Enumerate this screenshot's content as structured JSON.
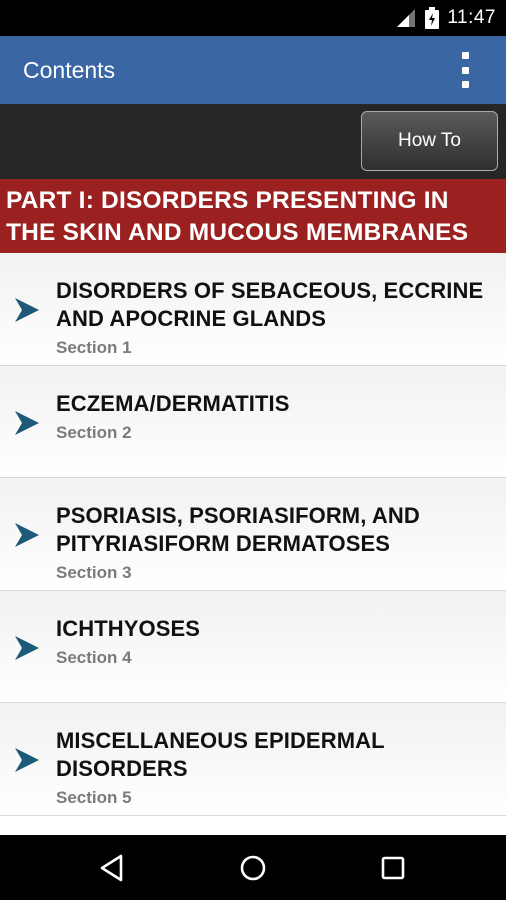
{
  "status_bar": {
    "time": "11:47"
  },
  "app_bar": {
    "title": "Contents",
    "menu_icon": "overflow-menu-icon"
  },
  "toolbar": {
    "how_to_label": "How To"
  },
  "part_header": {
    "title": "PART I: DISORDERS PRESENTING IN THE SKIN AND MUCOUS MEMBRANES"
  },
  "sections": [
    {
      "title": "DISORDERS OF SEBACEOUS, ECCRINE AND APOCRINE GLANDS",
      "subtitle": "Section 1"
    },
    {
      "title": "ECZEMA/DERMATITIS",
      "subtitle": "Section 2"
    },
    {
      "title": "PSORIASIS, PSORIASIFORM, AND PITYRIASIFORM DERMATOSES",
      "subtitle": "Section 3"
    },
    {
      "title": "ICHTHYOSES",
      "subtitle": "Section 4"
    },
    {
      "title": "MISCELLANEOUS EPIDERMAL DISORDERS",
      "subtitle": "Section 5"
    }
  ],
  "colors": {
    "app_bar": "#3a67a3",
    "part_header": "#9b2020",
    "chevron": "#1d5a7a"
  },
  "nav_bar": {
    "icons": [
      "back-icon",
      "home-icon",
      "recents-icon"
    ]
  }
}
